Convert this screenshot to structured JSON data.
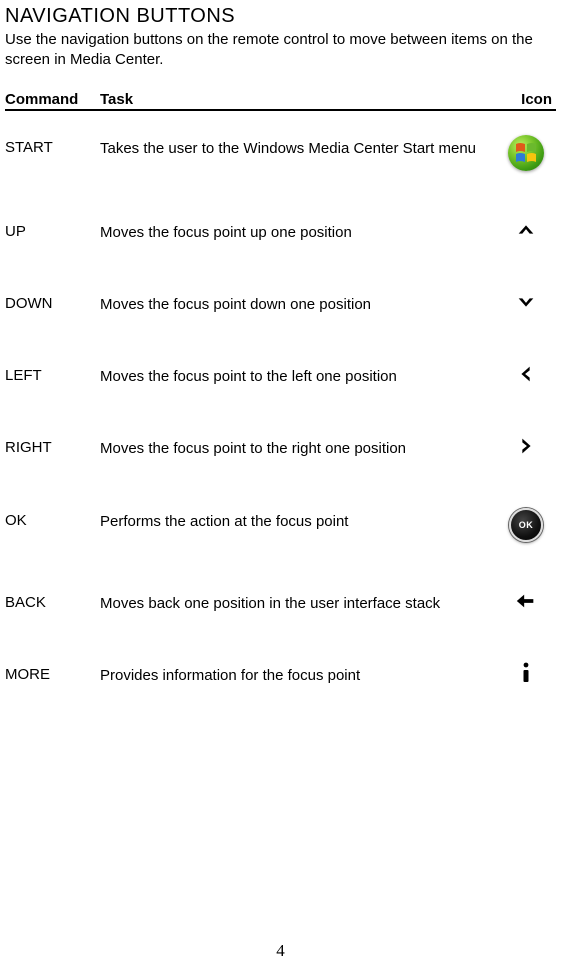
{
  "title": "NAVIGATION BUTTONS",
  "intro": "Use the navigation buttons on the remote control to move between items on the screen in Media Center.",
  "headers": {
    "command": "Command",
    "task": "Task",
    "icon": "Icon"
  },
  "rows": [
    {
      "command": "START",
      "task": "Takes the user to the Windows Media Center Start menu",
      "icon": "windows-start-icon"
    },
    {
      "command": "UP",
      "task": "Moves the focus point up one position",
      "icon": "arrow-up-icon"
    },
    {
      "command": "DOWN",
      "task": "Moves the focus point down one position",
      "icon": "arrow-down-icon"
    },
    {
      "command": "LEFT",
      "task": "Moves the focus point to the left one position",
      "icon": "arrow-left-icon"
    },
    {
      "command": "RIGHT",
      "task": "Moves the focus point to the right one position",
      "icon": "arrow-right-icon"
    },
    {
      "command": "OK",
      "task": "Performs the action at the focus point",
      "icon": "ok-button-icon"
    },
    {
      "command": "BACK",
      "task": "Moves back one position in the user interface stack",
      "icon": "arrow-back-icon"
    },
    {
      "command": "MORE",
      "task": "Provides information for the focus point",
      "icon": "info-icon"
    }
  ],
  "page_number": "4"
}
